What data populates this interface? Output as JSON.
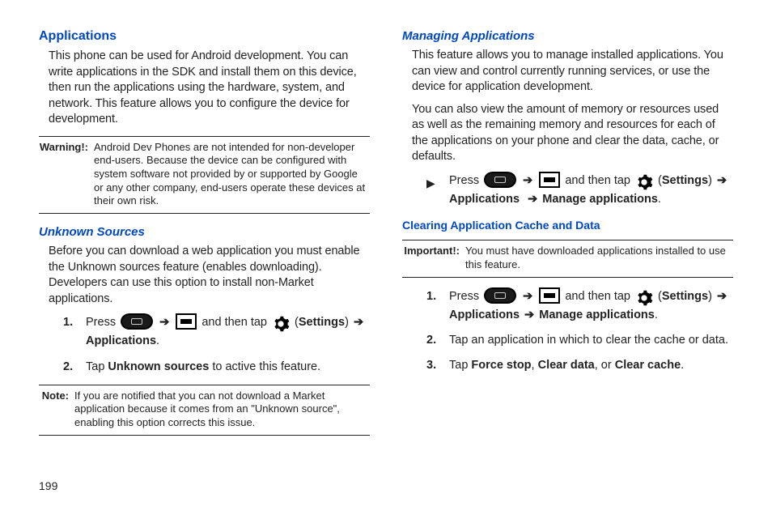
{
  "page_number": "199",
  "left": {
    "h1": "Applications",
    "intro": "This phone can be used for Android development. You can write applications in the SDK and install them on this device, then run the applications using the hardware, system, and network. This feature allows you to configure the device for development.",
    "warning_label": "Warning!:",
    "warning_body": "Android Dev Phones are not intended for non-developer end-users. Because the device can be configured with system software not provided by or supported by Google or any other company, end-users operate these devices at their own risk.",
    "h2_unknown": "Unknown Sources",
    "unknown_para": "Before you can download a web application you must enable the Unknown sources feature (enables downloading). Developers can use this option to install non-Market applications.",
    "step1_num": "1.",
    "step1_pre": "Press ",
    "step1_mid": " and then tap ",
    "step1_settings": "Settings",
    "step1_apps": "Applications",
    "step2_num": "2.",
    "step2_pre": "Tap ",
    "step2_bold": "Unknown sources",
    "step2_post": " to active this feature.",
    "note_label": "Note:",
    "note_body": "If you are notified that you can not download a Market application because it comes from an \"Unknown source\", enabling this option corrects this issue."
  },
  "right": {
    "h2_manage": "Managing Applications",
    "manage_para1": "This feature allows you to manage installed applications. You can view and control currently running services, or use the device for application development.",
    "manage_para2": "You can also view the amount of memory or resources used as well as the remaining memory and resources for each of the applications on your phone and clear the data, cache, or defaults.",
    "bullet_pre": "Press ",
    "bullet_mid": " and then tap ",
    "bullet_settings": "Settings",
    "bullet_apps": "Applications",
    "bullet_manage": "Manage applications",
    "h3_clear": "Clearing Application Cache and Data",
    "important_label": "Important!:",
    "important_body": "You must have downloaded applications installed to use this feature.",
    "c_step1_num": "1.",
    "c_step1_pre": "Press ",
    "c_step1_mid": " and then tap ",
    "c_step1_settings": "Settings",
    "c_step1_apps": "Applications",
    "c_step1_manage": "Manage applications",
    "c_step2_num": "2.",
    "c_step2": "Tap an application in which to clear the cache or data.",
    "c_step3_num": "3.",
    "c_step3_pre": "Tap ",
    "c_step3_b1": "Force stop",
    "c_step3_b2": "Clear data",
    "c_step3_or": ", or ",
    "c_step3_b3": "Clear cache",
    "c_step3_sep": ", "
  }
}
